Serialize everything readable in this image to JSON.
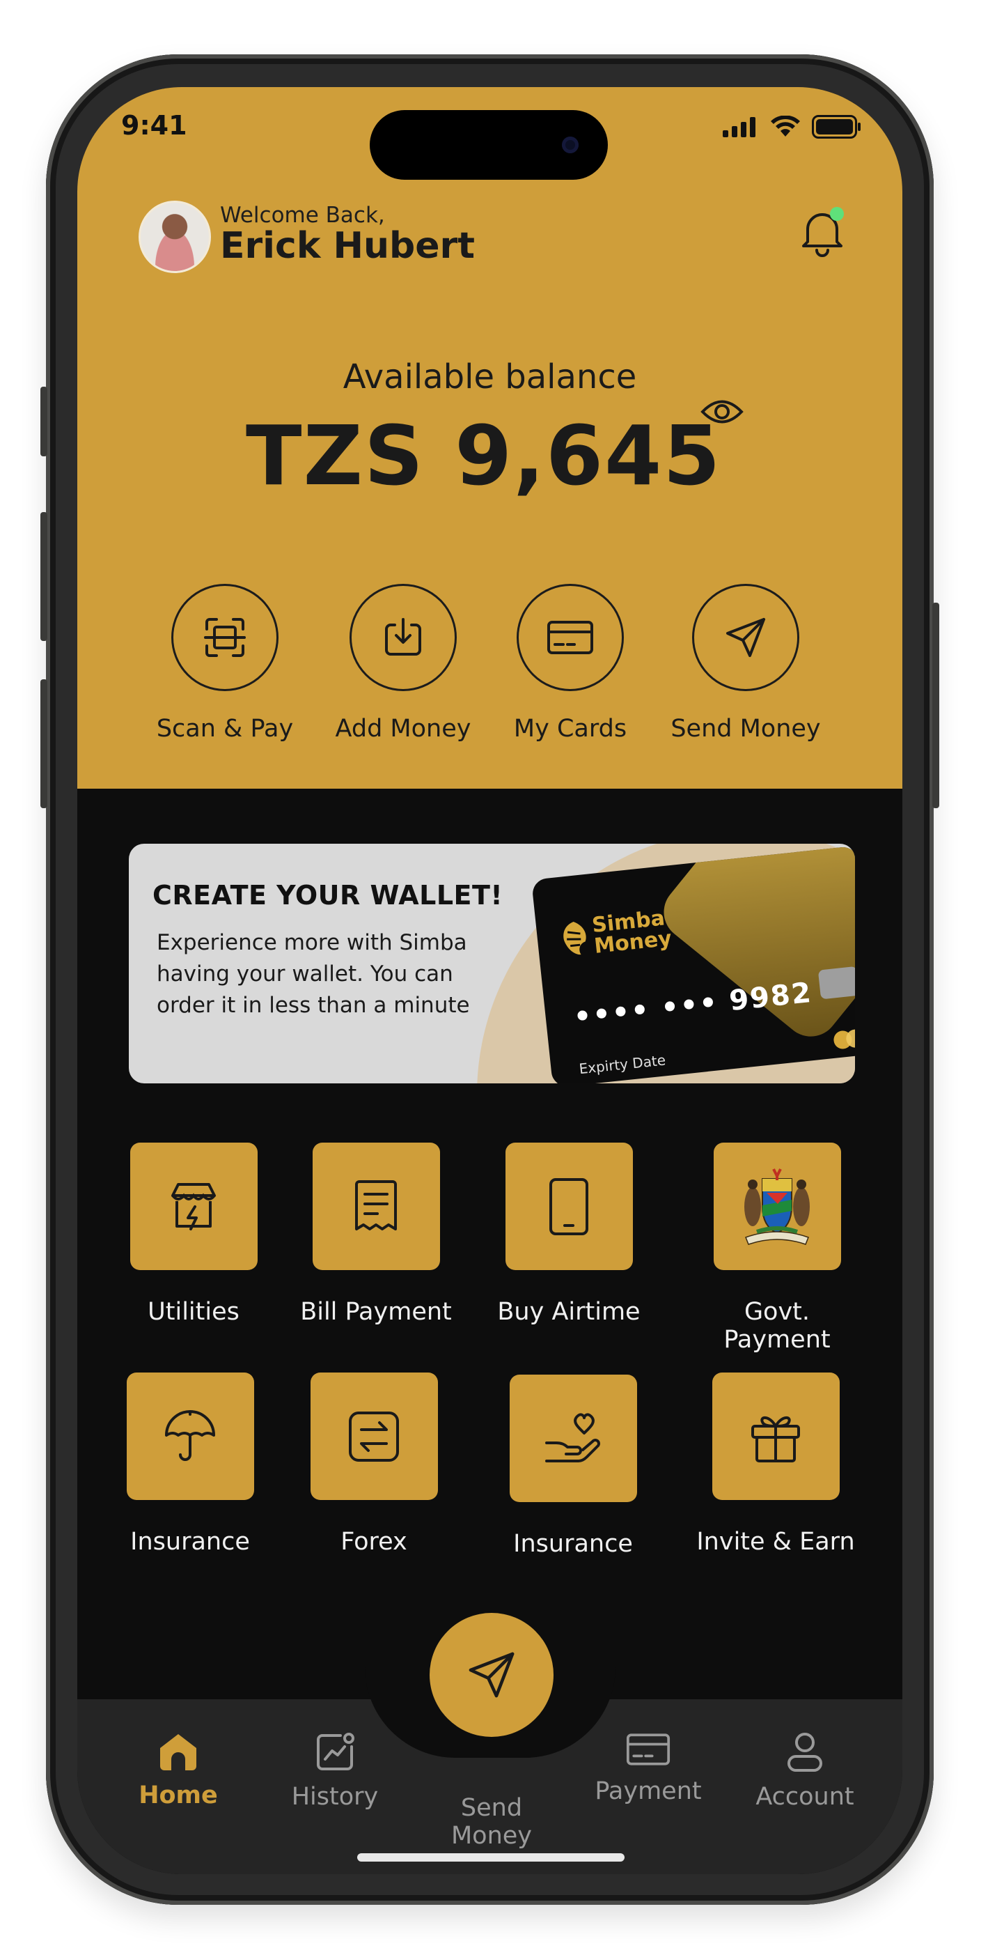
{
  "status": {
    "time": "9:41"
  },
  "header": {
    "welcome": "Welcome Back,",
    "user_name": "Erick Hubert"
  },
  "balance": {
    "label": "Available balance",
    "amount": "TZS 9,645"
  },
  "quick_actions": [
    {
      "label": "Scan & Pay",
      "icon": "scan-icon"
    },
    {
      "label": "Add Money",
      "icon": "download-icon"
    },
    {
      "label": "My Cards",
      "icon": "card-icon"
    },
    {
      "label": "Send Money",
      "icon": "send-icon"
    }
  ],
  "banner": {
    "title": "CREATE YOUR WALLET!",
    "description": "Experience more with Simba having your wallet. You can order it in less than a minute",
    "card_brand_line1": "Simba",
    "card_brand_line2": "Money",
    "card_number": "•••• ••• 9982",
    "card_expiry_label": "Expirty Date"
  },
  "services": [
    {
      "label": "Utilities",
      "icon": "utilities-icon"
    },
    {
      "label": "Bill Payment",
      "icon": "receipt-icon"
    },
    {
      "label": "Buy Airtime",
      "icon": "phone-icon"
    },
    {
      "label": "Govt. Payment",
      "icon": "coat-of-arms-icon"
    },
    {
      "label": "Insurance",
      "icon": "umbrella-icon"
    },
    {
      "label": "Forex",
      "icon": "exchange-icon"
    },
    {
      "label": "Insurance",
      "icon": "hand-heart-icon"
    },
    {
      "label": "Invite & Earn",
      "icon": "gift-icon"
    }
  ],
  "nav": [
    {
      "label": "Home",
      "icon": "home-icon",
      "active": true
    },
    {
      "label": "History",
      "icon": "history-icon"
    },
    {
      "label": "Send Money",
      "icon": "send-icon"
    },
    {
      "label": "Payment",
      "icon": "payment-icon"
    },
    {
      "label": "Account",
      "icon": "account-icon"
    }
  ],
  "colors": {
    "accent": "#cf9e3a",
    "background": "#0d0d0d",
    "nav_bg": "#252525",
    "notification_dot": "#5fe07a"
  }
}
